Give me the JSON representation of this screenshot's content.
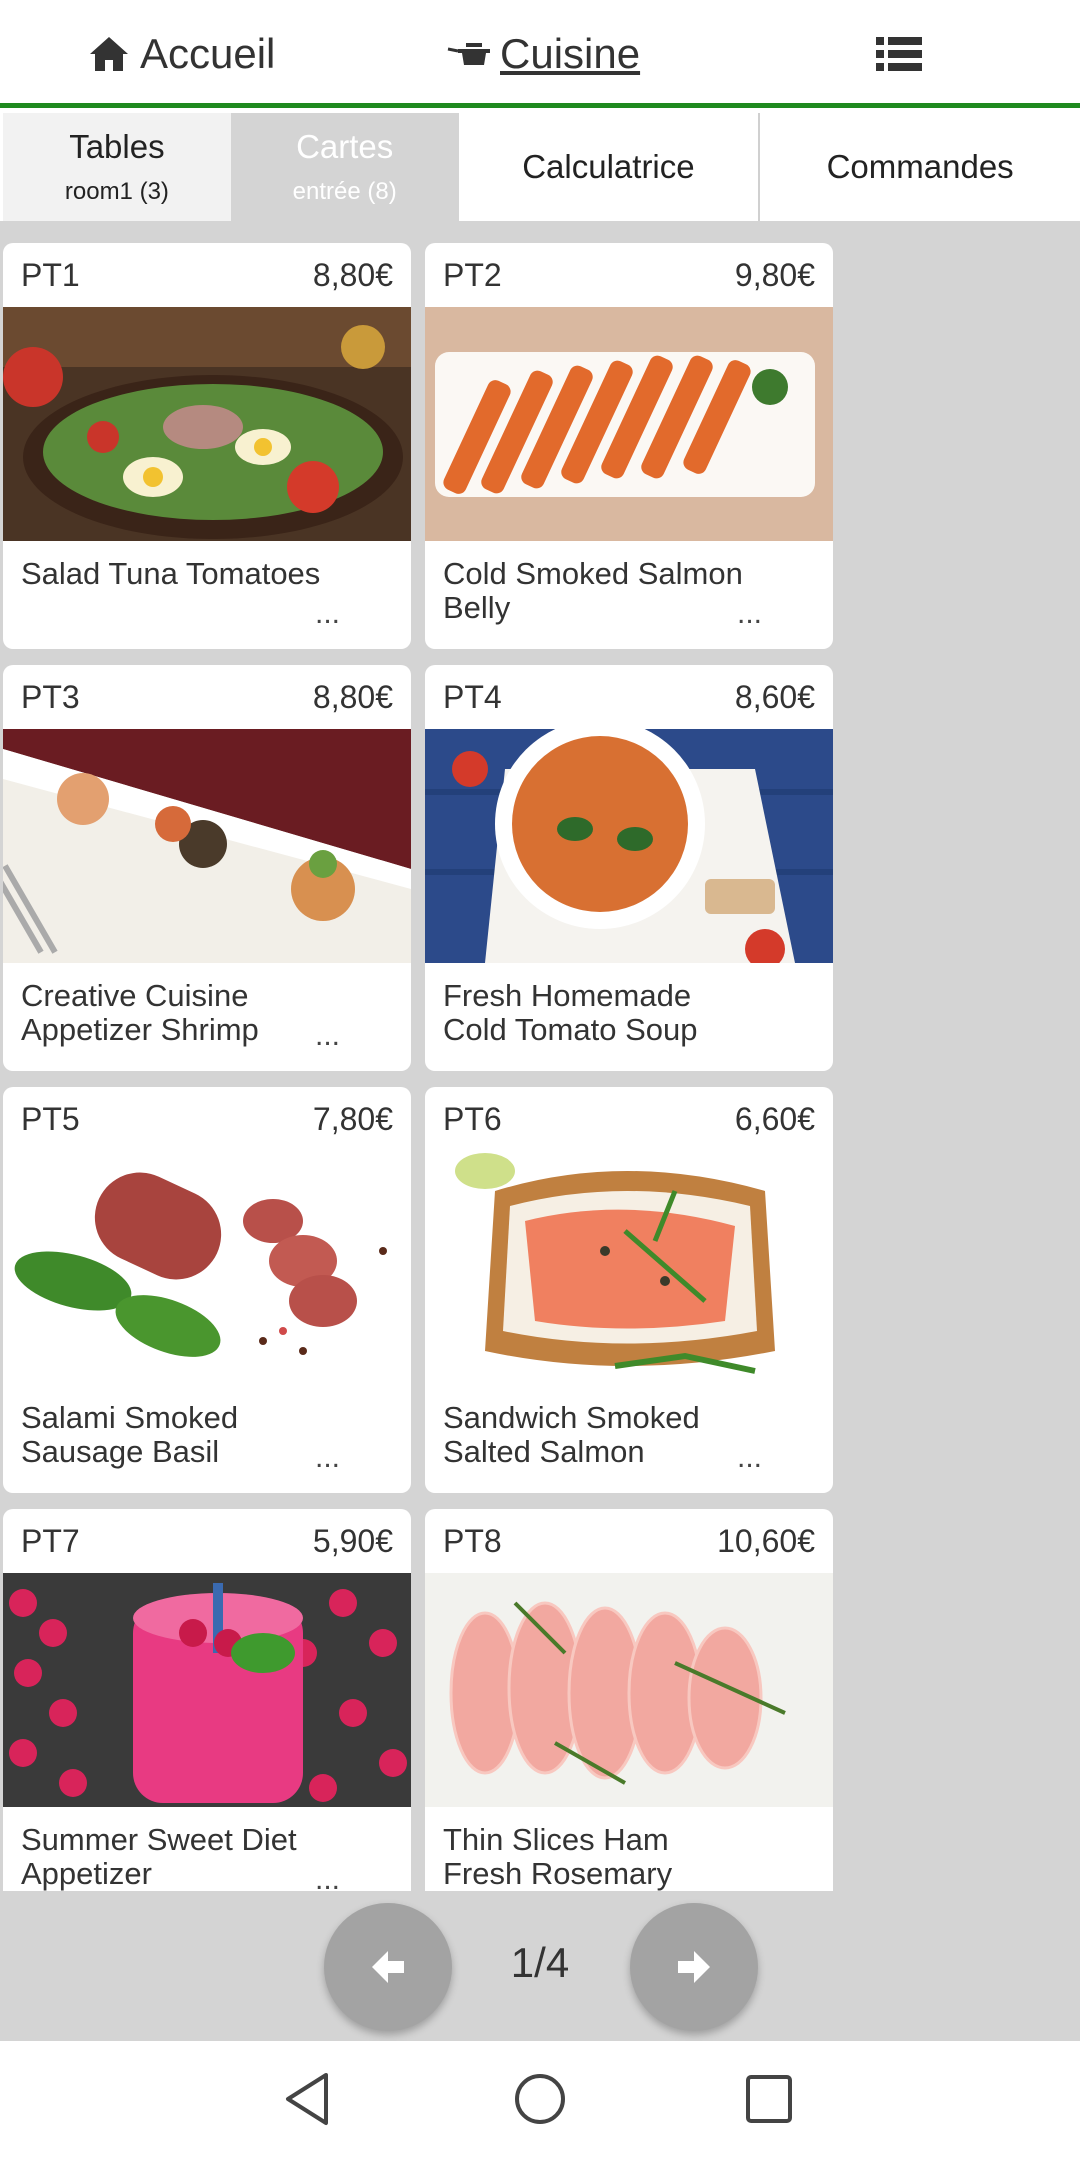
{
  "nav": {
    "home_label": "Accueil",
    "cuisine_label": "Cuisine",
    "home_icon": "home-icon",
    "cuisine_icon": "cooking-pot-icon",
    "menu_icon": "list-icon",
    "accent": "#1f8a1f"
  },
  "tabs": {
    "tables_label": "Tables",
    "tables_sub": "room1 (3)",
    "cartes_label": "Cartes",
    "cartes_sub": "entrée (8)",
    "calc_label": "Calculatrice",
    "cmd_label": "Commandes"
  },
  "products": [
    {
      "code": "PT1",
      "price": "8,80€",
      "name": "Salad Tuna Tomatoes",
      "more": "..."
    },
    {
      "code": "PT2",
      "price": "9,80€",
      "name": "Cold Smoked Salmon Belly",
      "more": "..."
    },
    {
      "code": "PT3",
      "price": "8,80€",
      "name": "Creative Cuisine Appetizer Shrimp",
      "more": "..."
    },
    {
      "code": "PT4",
      "price": "8,60€",
      "name": "Fresh Homemade Cold Tomato Soup",
      "more": ""
    },
    {
      "code": "PT5",
      "price": "7,80€",
      "name": "Salami Smoked Sausage Basil",
      "more": "..."
    },
    {
      "code": "PT6",
      "price": "6,60€",
      "name": "Sandwich Smoked Salted Salmon",
      "more": "..."
    },
    {
      "code": "PT7",
      "price": "5,90€",
      "name": "Summer Sweet Diet Appetizer",
      "more": "..."
    },
    {
      "code": "PT8",
      "price": "10,60€",
      "name": "Thin Slices Ham Fresh Rosemary",
      "more": ""
    }
  ],
  "pager": {
    "label": "1/4",
    "prev_icon": "arrow-left-icon",
    "next_icon": "arrow-right-icon"
  }
}
